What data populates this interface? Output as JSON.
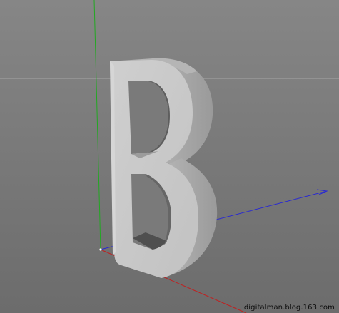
{
  "viewport": {
    "background_top": "#878787",
    "background_bottom": "#6b6b6b",
    "axis_colors": {
      "x": "#2a2ad0",
      "y": "#22a822",
      "z": "#c02020"
    },
    "horizon_color": "#a9a9a9",
    "object": {
      "glyph": "B",
      "front_color": "#c8c8c8",
      "side_color": "#a6a6a6",
      "dark_side_color": "#5f5f5f"
    }
  },
  "watermark": "digitalman.blog.163.com"
}
